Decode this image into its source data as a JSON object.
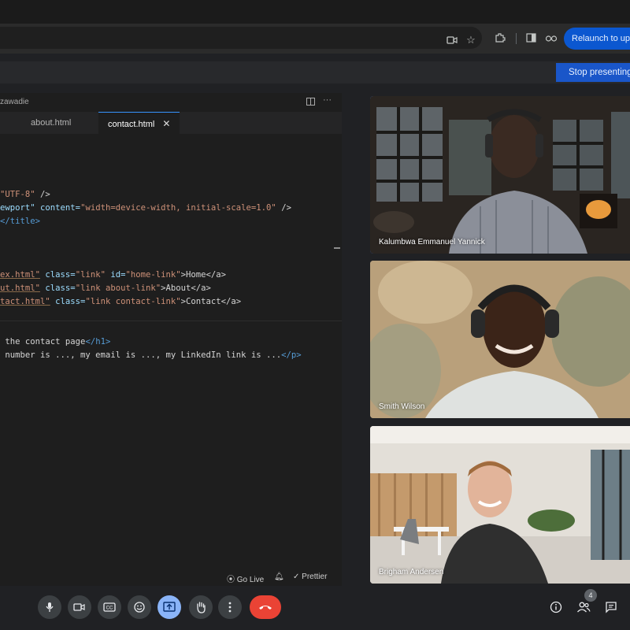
{
  "browser": {
    "relaunch_label": "Relaunch to upd"
  },
  "meet": {
    "stop_presenting_label": "Stop presenting"
  },
  "editor": {
    "title": "zawadie",
    "tabs": [
      {
        "label": "about.html",
        "active": false
      },
      {
        "label": "contact.html",
        "active": true
      }
    ],
    "status": {
      "go_live": "Go Live",
      "prettier": "Prettier"
    }
  },
  "code_lines": {
    "l1": {
      "s1": "\"UTF-8\"",
      "t1": " />"
    },
    "l2": {
      "a1": "ewport\"",
      "a2": " content=",
      "s1": "\"width=device-width, initial-scale=1.0\"",
      "t1": " />"
    },
    "l3": {
      "t1": "</title>"
    },
    "l4": {
      "s1": "ex.html\"",
      "a1": " class=",
      "s2": "\"link\"",
      "a2": " id=",
      "s3": "\"home-link\"",
      "t1": ">Home</a>"
    },
    "l5": {
      "s1": "ut.html\"",
      "a1": " class=",
      "s2": "\"link about-link\"",
      "t1": ">About</a>"
    },
    "l6": {
      "s1": "tact.html\"",
      "a1": " class=",
      "s2": "\"link contact-link\"",
      "t1": ">Contact</a>"
    },
    "l7": {
      "t1": " the contact page",
      "g1": "</h1>"
    },
    "l8": {
      "t1": " number is ..., my email is ..., my LinkedIn link is ...",
      "g1": "</p>"
    }
  },
  "participants": [
    {
      "name": "Kalumbwa Emmanuel Yannick",
      "speaking": true
    },
    {
      "name": "Smith Wilson",
      "speaking": false
    },
    {
      "name": "Brigham Andersen",
      "speaking": false
    }
  ],
  "controls": {
    "people_count": "4",
    "icons": [
      "mic-icon",
      "camera-icon",
      "captions-icon",
      "emoji-icon",
      "present-icon",
      "raise-hand-icon",
      "more-icon",
      "end-call-icon"
    ],
    "right_icons": [
      "info-icon",
      "people-icon",
      "chat-icon"
    ],
    "accent": "#8ab4f8",
    "end_call_color": "#ea4335"
  }
}
